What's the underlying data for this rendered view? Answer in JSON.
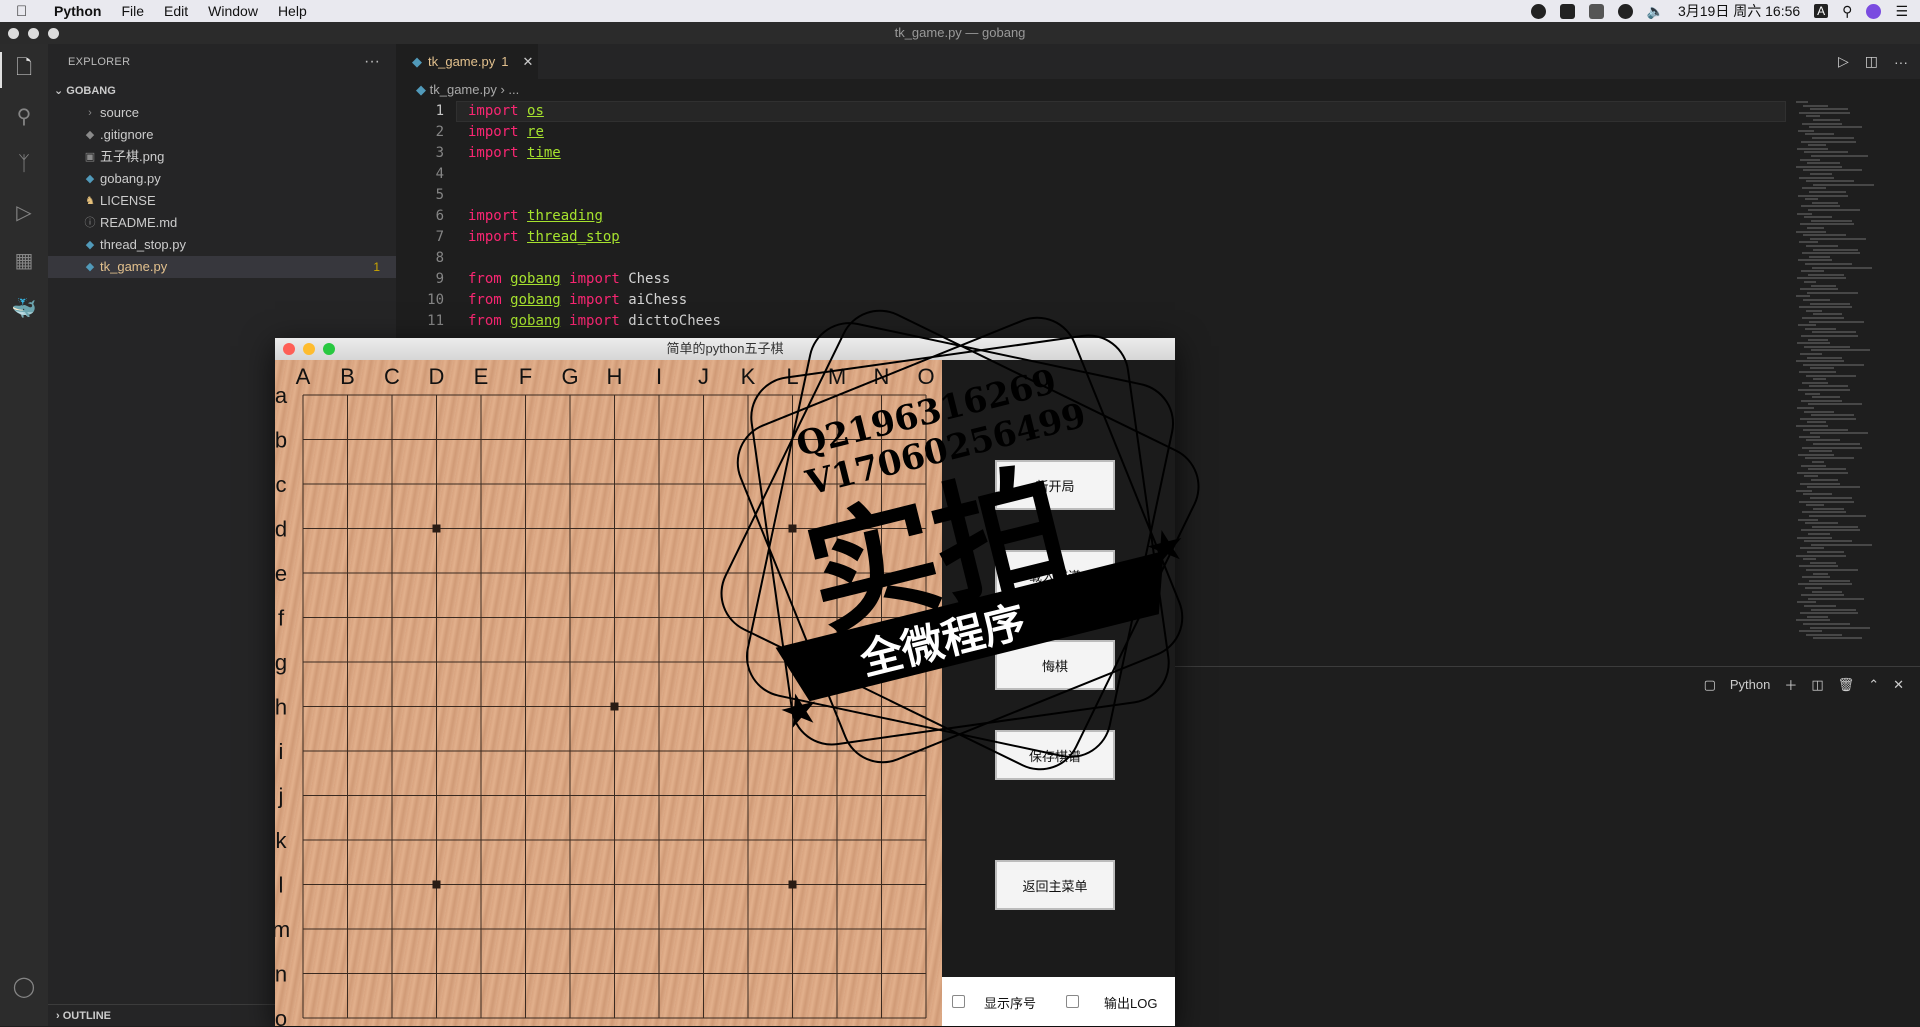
{
  "menubar": {
    "apple": "",
    "items": [
      "Python",
      "File",
      "Edit",
      "Window",
      "Help"
    ],
    "clock": "3月19日 周六 16:56",
    "input_method": "A"
  },
  "window": {
    "title": "tk_game.py — gobang"
  },
  "explorer": {
    "header": "EXPLORER",
    "more": "···",
    "folder": "GOBANG",
    "files": [
      {
        "name": "source",
        "icon": "chevron-right-icon",
        "glyph": "›",
        "selected": false,
        "badge": ""
      },
      {
        "name": ".gitignore",
        "icon": "gitignore-icon",
        "glyph": "◆",
        "selected": false,
        "badge": ""
      },
      {
        "name": "五子棋.png",
        "icon": "image-icon",
        "glyph": "▣",
        "selected": false,
        "badge": ""
      },
      {
        "name": "gobang.py",
        "icon": "python-icon",
        "glyph": "◆",
        "selected": false,
        "badge": ""
      },
      {
        "name": "LICENSE",
        "icon": "license-icon",
        "glyph": "♞",
        "selected": false,
        "badge": ""
      },
      {
        "name": "README.md",
        "icon": "info-icon",
        "glyph": "ⓘ",
        "selected": false,
        "badge": ""
      },
      {
        "name": "thread_stop.py",
        "icon": "python-icon",
        "glyph": "◆",
        "selected": false,
        "badge": ""
      },
      {
        "name": "tk_game.py",
        "icon": "python-icon",
        "glyph": "◆",
        "selected": true,
        "badge": "1"
      }
    ],
    "outline": "OUTLINE"
  },
  "editor": {
    "tab_label": "tk_game.py",
    "tab_badge": "1",
    "breadcrumb_file": "tk_game.py",
    "breadcrumb_more": "...",
    "lines": [
      {
        "n": "1",
        "kw": "import",
        "mod": "os",
        "rest": ""
      },
      {
        "n": "2",
        "kw": "import",
        "mod": "re",
        "rest": ""
      },
      {
        "n": "3",
        "kw": "import",
        "mod": "time",
        "rest": ""
      },
      {
        "n": "4",
        "kw": "",
        "mod": "",
        "rest": ""
      },
      {
        "n": "5",
        "kw": "",
        "mod": "",
        "rest": ""
      },
      {
        "n": "6",
        "kw": "import",
        "mod": "threading",
        "rest": ""
      },
      {
        "n": "7",
        "kw": "import",
        "mod": "thread_stop",
        "rest": ""
      },
      {
        "n": "8",
        "kw": "",
        "mod": "",
        "rest": ""
      },
      {
        "n": "9",
        "kw": "from",
        "mod": "gobang",
        "kw2": "import",
        "name": "Chess"
      },
      {
        "n": "10",
        "kw": "from",
        "mod": "gobang",
        "kw2": "import",
        "name": "aiChess"
      },
      {
        "n": "11",
        "kw": "from",
        "mod": "gobang",
        "kw2": "import",
        "name": "dicttoChees"
      }
    ]
  },
  "terminal": {
    "label": "Python"
  },
  "tk": {
    "title": "简单的python五子棋",
    "columns": [
      "A",
      "B",
      "C",
      "D",
      "E",
      "F",
      "G",
      "H",
      "I",
      "J",
      "K",
      "L",
      "M",
      "N",
      "O"
    ],
    "rows": [
      "a",
      "b",
      "c",
      "d",
      "e",
      "f",
      "g",
      "h",
      "i",
      "j",
      "k",
      "l",
      "m",
      "n",
      "o"
    ],
    "buttons": {
      "new_game": "新开局",
      "load": "载入棋谱",
      "undo": "悔棋",
      "save": "保存棋谱",
      "back": "返回主菜单"
    },
    "show_index": "显示序号",
    "output_log": "输出LOG"
  },
  "stamp": {
    "line1": "Q2196316269",
    "line2": "V17060256499",
    "big": "实拍",
    "banner": "全微程序"
  }
}
